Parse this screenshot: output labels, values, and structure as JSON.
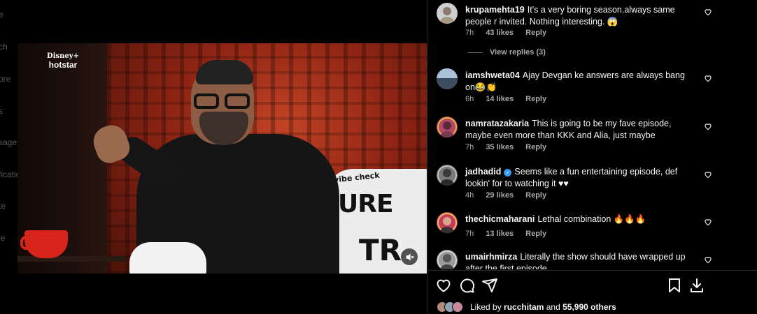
{
  "sidebar": {
    "items": [
      {
        "label": "e",
        "top": 0
      },
      {
        "label": "ch"
      },
      {
        "label": "ore"
      },
      {
        "label": "s"
      },
      {
        "label": "sages"
      },
      {
        "label": "fications"
      },
      {
        "label": "te"
      },
      {
        "label": "le"
      }
    ]
  },
  "media": {
    "brand_line1": "Disney+",
    "brand_line2": "hotstar",
    "sofa_text1": "vibe check",
    "sofa_text2": "URE",
    "sofa_text3": "TR",
    "mute_icon": "speaker-muted-icon"
  },
  "comments": [
    {
      "user": "krupamehta19",
      "verified": false,
      "text": "It's a very boring season.always same people r invited. Nothing interesting. 😱",
      "time": "7h",
      "likes": "43 likes",
      "reply": "Reply",
      "avatar_color": "#cfcfcf"
    },
    {
      "user": "iamshweta04",
      "verified": false,
      "text": "Ajay Devgan ke answers are always bang on😂👏",
      "time": "6h",
      "likes": "14 likes",
      "reply": "Reply",
      "avatar_color": "#6f8aa3"
    },
    {
      "user": "namratazakaria",
      "verified": false,
      "text": "This is going to be my fave episode, maybe even more than KKK and Alia, just maybe",
      "time": "7h",
      "likes": "35 likes",
      "reply": "Reply",
      "avatar_color": "#b5476a"
    },
    {
      "user": "jadhadid",
      "verified": true,
      "text": "Seems like a fun entertaining episode, def lookin' for to watching it ♥♥",
      "time": "4h",
      "likes": "29 likes",
      "reply": "Reply",
      "avatar_color": "#7a7a7a"
    },
    {
      "user": "thechicmaharani",
      "verified": false,
      "text": "Lethal combination 🔥🔥🔥",
      "time": "7h",
      "likes": "13 likes",
      "reply": "Reply",
      "avatar_color": "#c73a5c"
    },
    {
      "user": "umairhmirza",
      "verified": false,
      "text": "Literally the show should have wrapped up after the first episode",
      "time": "",
      "likes": "",
      "reply": "",
      "avatar_color": "#9a9a9a"
    }
  ],
  "view_replies": "View replies (3)",
  "actions": {
    "like": "heart-icon",
    "comment": "comment-icon",
    "share": "send-icon",
    "save": "bookmark-icon",
    "download": "download-icon"
  },
  "likes": {
    "prefix": "Liked by",
    "user": "rucchitam",
    "and": "and",
    "others": "55,990 others"
  }
}
